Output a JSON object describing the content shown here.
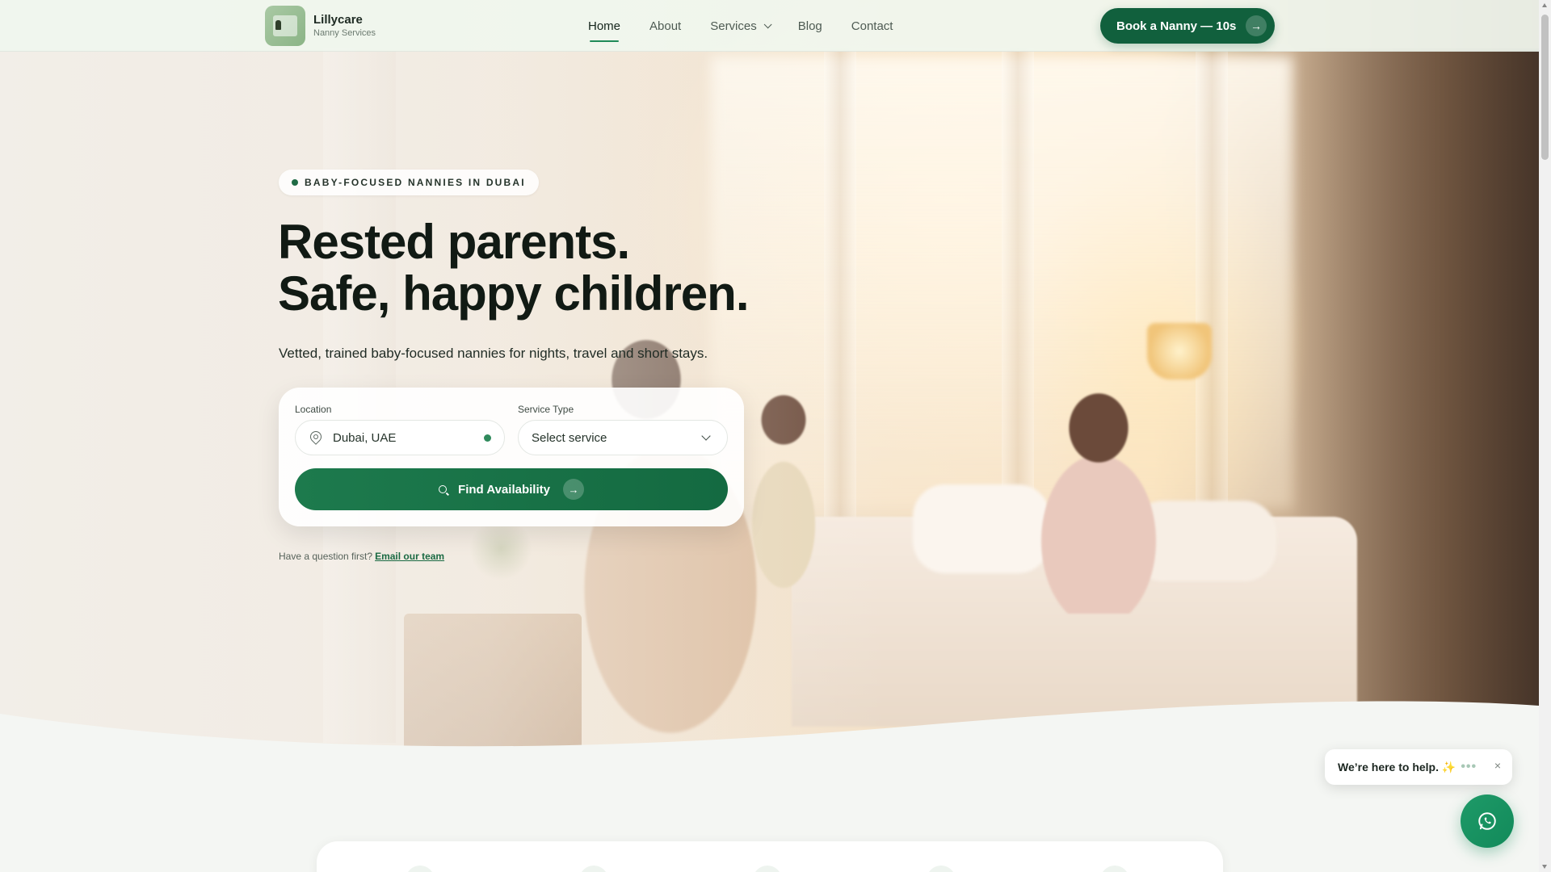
{
  "brand": {
    "name": "Lillycare",
    "tagline": "Nanny Services"
  },
  "nav": {
    "items": [
      {
        "label": "Home",
        "active": true
      },
      {
        "label": "About"
      },
      {
        "label": "Services",
        "dropdown": true
      },
      {
        "label": "Blog"
      },
      {
        "label": "Contact"
      }
    ],
    "cta_label": "Book a Nanny — 10s",
    "cta_arrow": "→"
  },
  "hero": {
    "badge": "BABY-FOCUSED NANNIES IN DUBAI",
    "headline_line1": "Rested parents.",
    "headline_line2": "Safe, happy children.",
    "subline": "Vetted, trained baby-focused nannies for nights, travel and short stays.",
    "question_text": "Have a question first?",
    "question_link": "Email our team"
  },
  "search": {
    "location_label": "Location",
    "location_value": "Dubai, UAE",
    "service_label": "Service Type",
    "service_value": "Select service",
    "find_label": "Find Availability",
    "find_arrow": "→"
  },
  "chat": {
    "message": "We’re here to help. ✨",
    "typing": "•••",
    "close": "×"
  },
  "colors": {
    "primary": "#11603d",
    "accent": "#1f8a58",
    "whatsapp": "#1e9a68"
  },
  "icons": [
    "location-pin-icon",
    "chevron-down-icon",
    "search-icon",
    "arrow-right-icon",
    "whatsapp-icon",
    "close-icon"
  ]
}
